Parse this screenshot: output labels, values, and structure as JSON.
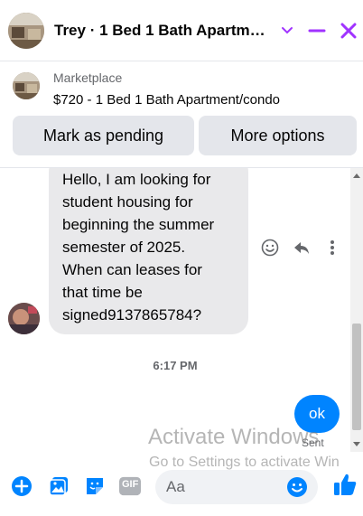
{
  "header": {
    "title": "Trey · 1 Bed 1 Bath Apartm…",
    "icons": [
      "chevron-down-icon",
      "minimize-icon",
      "close-icon"
    ]
  },
  "listing": {
    "source": "Marketplace",
    "title": "$720 - 1 Bed 1 Bath Apartment/condo",
    "buttons": {
      "pending": "Mark as pending",
      "more": "More options"
    }
  },
  "conversation": {
    "incoming": {
      "lines": [
        "Hello, I am looking for",
        "student housing for",
        "beginning the summer",
        "semester of 2025.",
        "When can leases for",
        "that time be",
        "signed9137865784?"
      ]
    },
    "timestamp": "6:17 PM",
    "outgoing": {
      "text": "ok",
      "status": "Sent"
    }
  },
  "watermark": {
    "line1": "Activate Windows",
    "line2": "Go to Settings to activate Win"
  },
  "composer": {
    "placeholder": "Aa",
    "gif_label": "GIF"
  },
  "colors": {
    "accent": "#0084ff",
    "header_icons": "#a033ff",
    "bubble_in": "#e9e9eb"
  }
}
